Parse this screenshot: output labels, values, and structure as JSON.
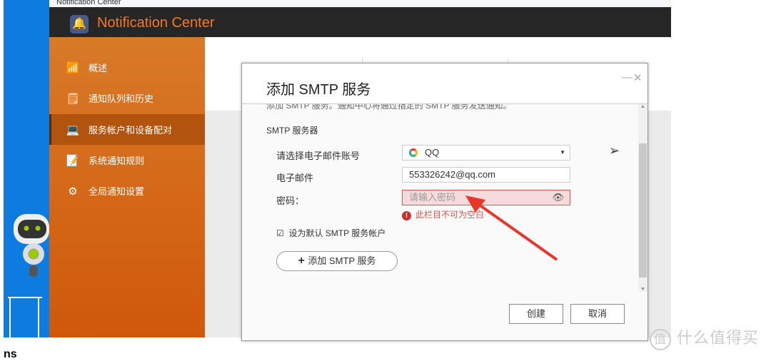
{
  "window": {
    "title": "Notification Center",
    "app_title": "Notification Center"
  },
  "sidebar": {
    "items": [
      {
        "label": "概述",
        "icon": "chart-icon"
      },
      {
        "label": "通知队列和历史",
        "icon": "history-icon"
      },
      {
        "label": "服务帐户和设备配对",
        "icon": "devices-icon",
        "active": true
      },
      {
        "label": "系统通知规则",
        "icon": "rules-icon"
      },
      {
        "label": "全局通知设置",
        "icon": "toggle-icon"
      }
    ]
  },
  "dialog": {
    "title": "添加 SMTP 服务",
    "intro": "添加 SMTP 服务。通知中心将通过指定的 SMTP 服务发送通知。",
    "section": "SMTP 服务器",
    "account_label": "请选择电子邮件账号",
    "account_value": "QQ",
    "email_label": "电子邮件",
    "email_value": "553326242@qq.com",
    "password_label": "密码：",
    "password_placeholder": "请输入密码",
    "error": "此栏目不可为空白",
    "default_label": "设为默认 SMTP 服务帐户",
    "default_checked": true,
    "add_button": "添加 SMTP 服务",
    "create": "创建",
    "cancel": "取消"
  },
  "watermark": "什么值得买",
  "watermark_badge": "值",
  "footer_text": "ns",
  "colors": {
    "accent": "#f47a1f",
    "error": "#d9534f",
    "arrow": "#e8362b"
  }
}
